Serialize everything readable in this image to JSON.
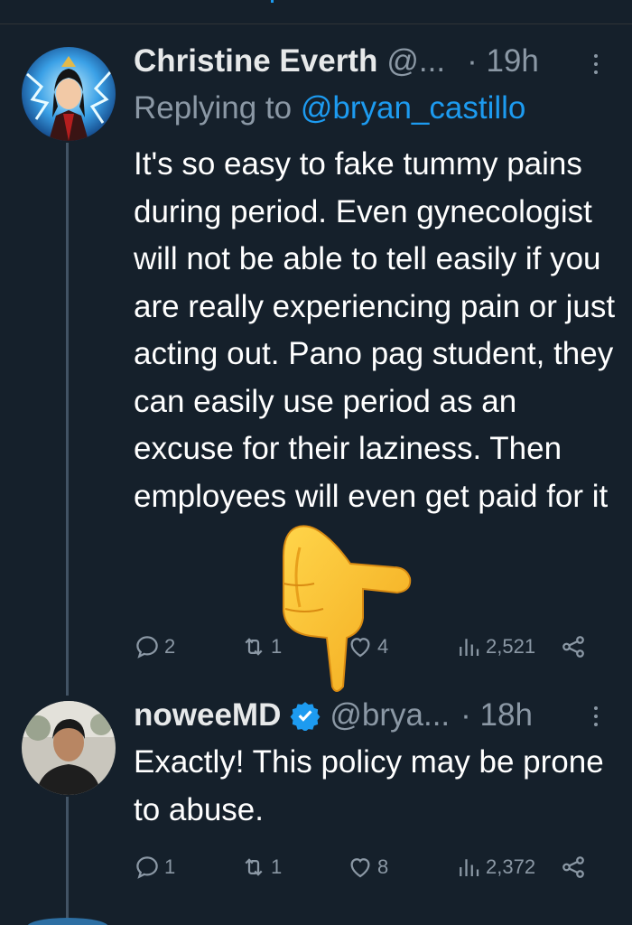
{
  "tweets": [
    {
      "name": "Christine Everth",
      "handle": "@...",
      "time": "· 19h",
      "reply_prefix": "Replying to ",
      "reply_handle": "@bryan_castillo",
      "text": "It's so easy to fake tummy pains during period. Even gynecologist will not be able to tell easily if you are really experiencing pain or just acting out. Pano pag student, they can easily use period as an excuse for their laziness. Then employees will even get paid for it",
      "replies": "2",
      "retweets": "1",
      "likes": "4",
      "views": "2,521"
    },
    {
      "name": "noweeMD",
      "handle": "@brya...",
      "time": "· 18h",
      "verified": true,
      "text": "Exactly! This policy may be prone to abuse.",
      "replies": "1",
      "retweets": "1",
      "likes": "8",
      "views": "2,372"
    }
  ],
  "colors": {
    "background": "#15202b",
    "accent": "#1d9bf0",
    "muted": "#8b98a5"
  },
  "icons": [
    "reply-icon",
    "retweet-icon",
    "like-icon",
    "views-icon",
    "share-icon",
    "more-icon",
    "verified-badge-icon",
    "pointing-hand-emoji"
  ]
}
